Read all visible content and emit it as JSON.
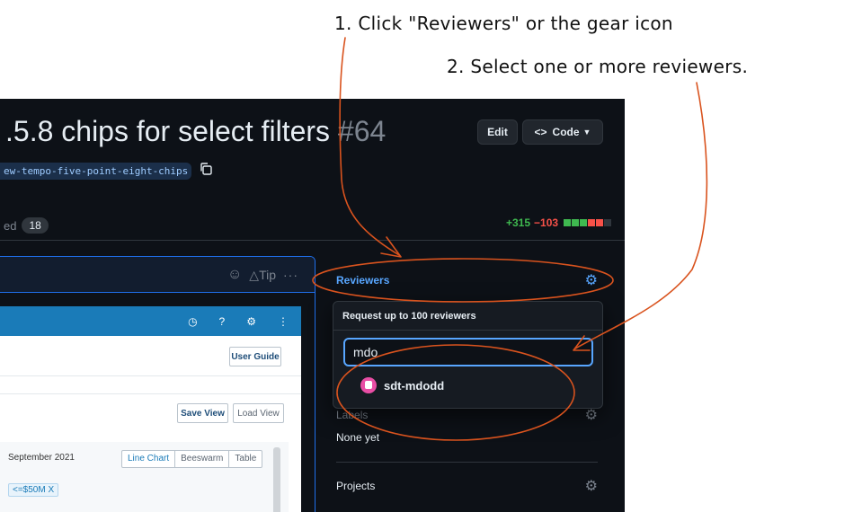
{
  "annotations": {
    "step1": "1. Click \"Reviewers\" or the gear icon",
    "step2": "2. Select one or more reviewers."
  },
  "header": {
    "title": ".5.8 chips for select filters",
    "number": "#64",
    "edit_label": "Edit",
    "code_label": "Code",
    "branch": "ew-tempo-five-point-eight-chips"
  },
  "tabs": {
    "fragment_label": "ed",
    "fragment_count": "18"
  },
  "diffstat": {
    "additions": "+315",
    "deletions": "−103",
    "bars": [
      "#3fb950",
      "#3fb950",
      "#3fb950",
      "#f85149",
      "#f85149",
      "#30363d"
    ]
  },
  "comment": {
    "tip_label": "Tip",
    "more_label": "···"
  },
  "screenshot_app": {
    "user_guide": "User Guide",
    "save_view": "Save View",
    "load_view": "Load View",
    "date_label": "September 2021",
    "segments": [
      "Line Chart",
      "Beeswarm",
      "Table"
    ],
    "chip": "<=$50M  X"
  },
  "sidebar": {
    "reviewers_label": "Reviewers",
    "labels_label": "Labels",
    "labels_value": "None yet",
    "projects_label": "Projects"
  },
  "reviewer_popover": {
    "title": "Request up to 100 reviewers",
    "search_value": "mdo",
    "result_name": "sdt-mdodd"
  },
  "colors": {
    "accent": "#58a6ff",
    "annotation_stroke": "#d9531e"
  }
}
